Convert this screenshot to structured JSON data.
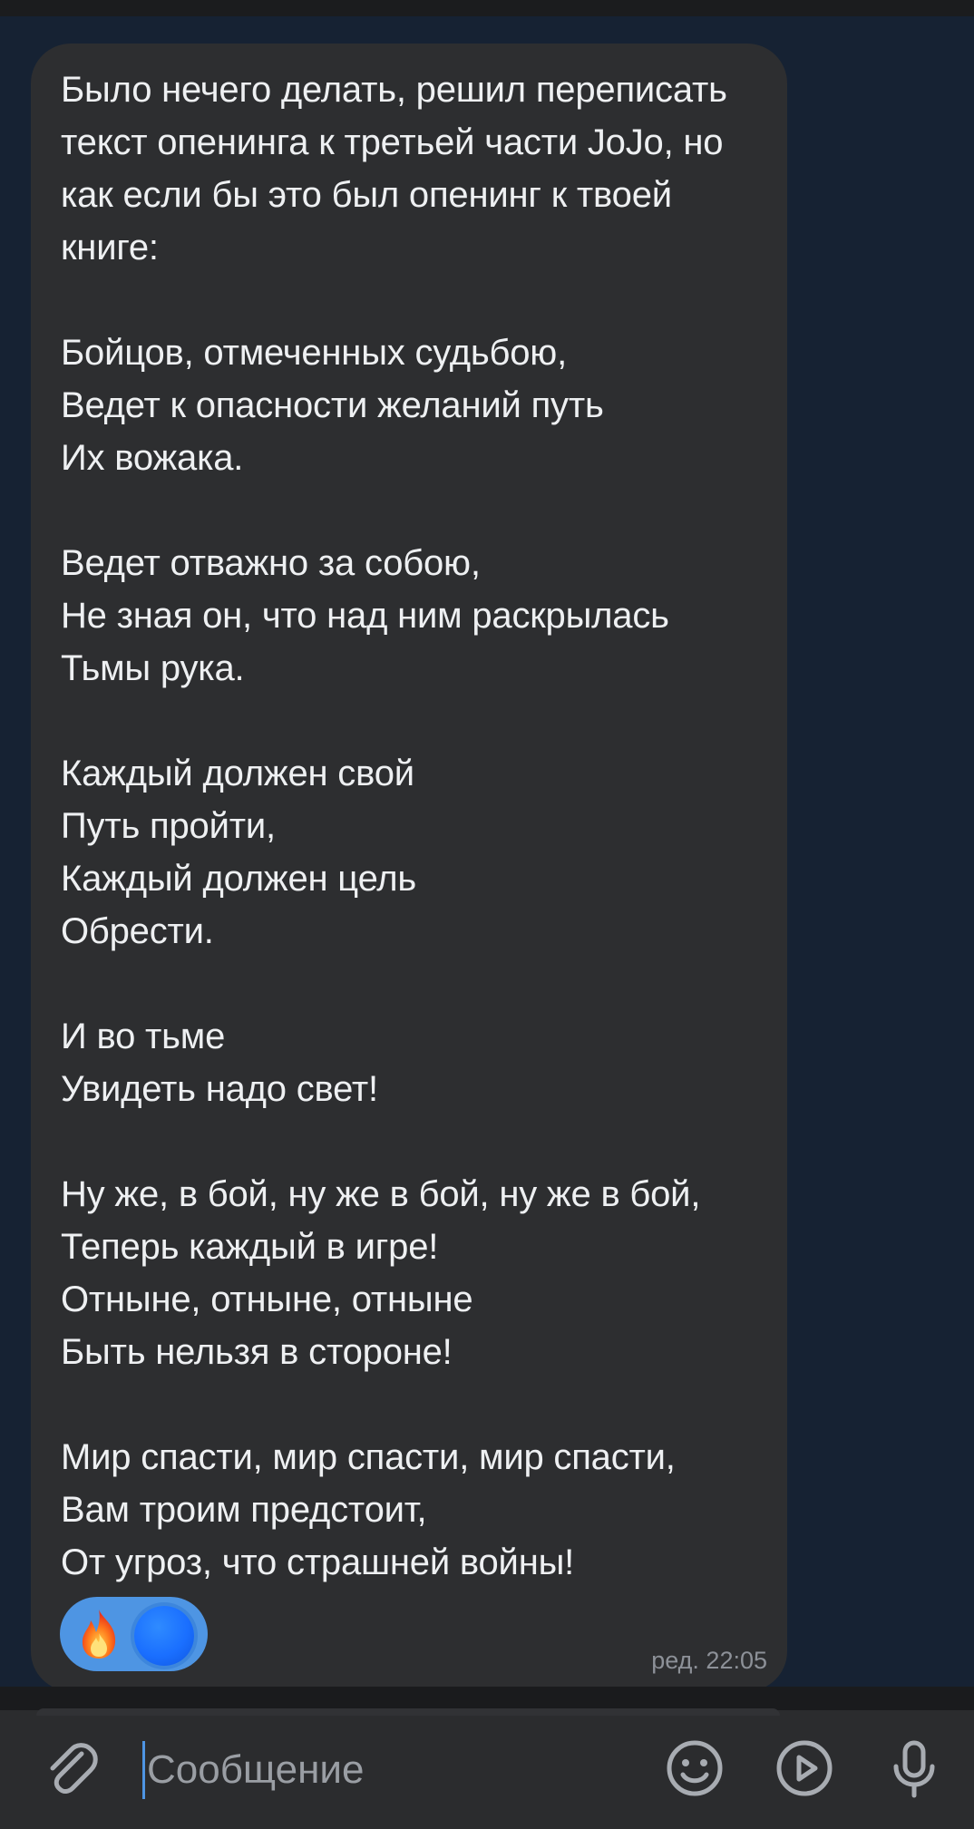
{
  "message": {
    "text": "Было нечего делать, решил переписать текст опенинга к третьей части JoJo, но как если бы это был опенинг к твоей книге:\n\nБойцов, отмеченных судьбою,\nВедет к опасности желаний путь\nИх вожака.\n\nВедет отважно за собою,\nНе зная он, что над ним раскрылась\nТьмы рука.\n\nКаждый должен свой\nПуть пройти,\nКаждый должен цель\nОбрести.\n\nИ во тьме\nУвидеть надо свет!\n\nНу же, в бой, ну же в бой, ну же в бой,\nТеперь каждый в игре!\nОтныне, отныне, отныне\nБыть нельзя в стороне!\n\nМир спасти, мир спасти, мир спасти,\nВам троим предстоит,\nОт угроз, что страшней войны!",
    "edited_time": "ред. 22:05",
    "reaction": {
      "emoji_icon": "fire-icon",
      "reactor": "avatar"
    }
  },
  "composer": {
    "placeholder": "Сообщение",
    "icons": {
      "attach": "paperclip-icon",
      "emoji": "smiley-icon",
      "video": "play-circle-icon",
      "mic": "microphone-icon"
    }
  },
  "colors": {
    "chat_background": "#162233",
    "bubble": "#2d2e30",
    "reaction_pill": "#4e95e3",
    "composer": "#2b2c2e",
    "text": "#eef0f2",
    "meta_text": "#8d9198"
  }
}
